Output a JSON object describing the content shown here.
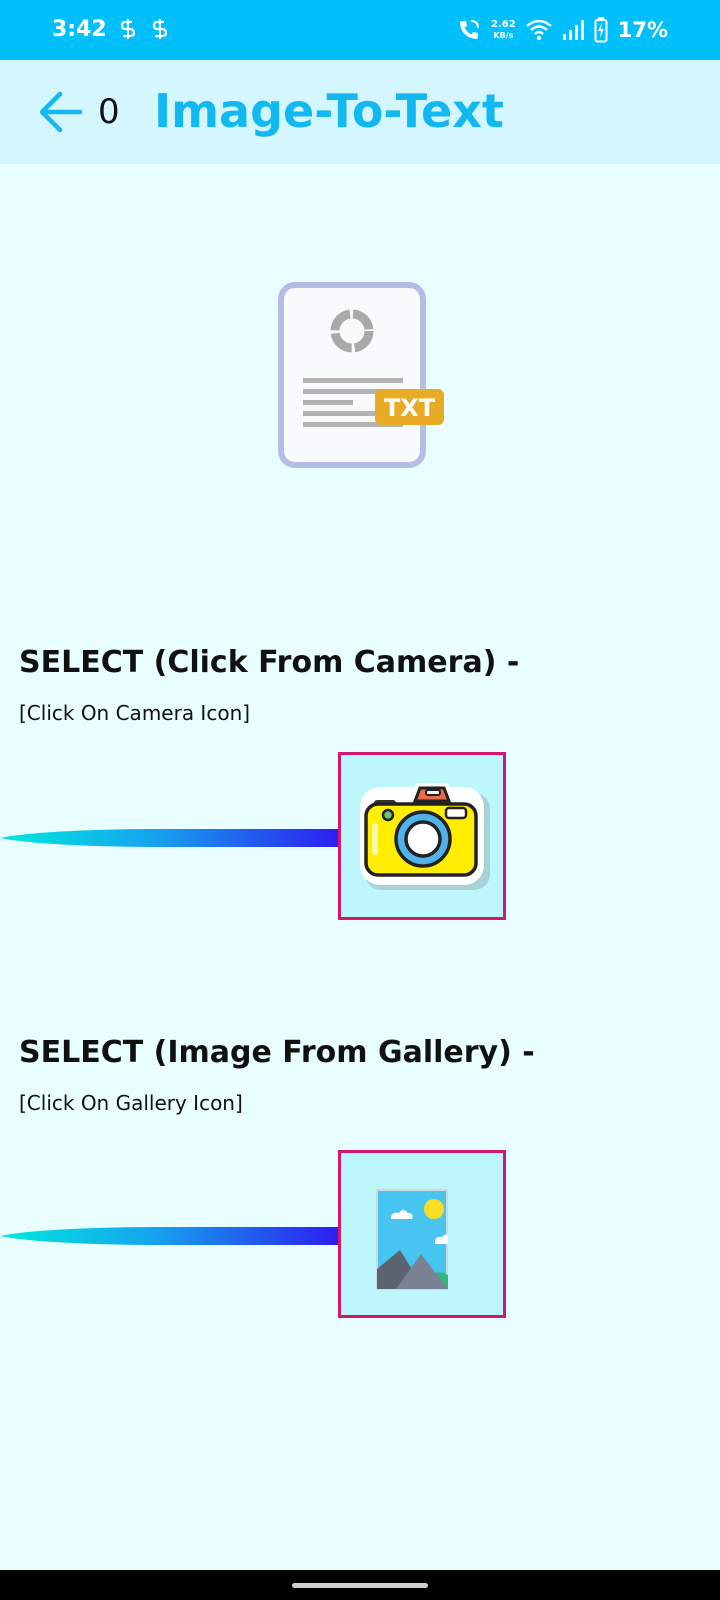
{
  "status_bar": {
    "time": "3:42",
    "speed_value": "2.62",
    "speed_unit": "KB/s",
    "battery": "17%"
  },
  "app_bar": {
    "counter": "0",
    "title": "Image-To-Text",
    "title_color": "#12b8f0"
  },
  "hero": {
    "badge_text": "TXT"
  },
  "camera_section": {
    "title": "SELECT (Click From Camera) -",
    "hint": "[Click On Camera Icon]"
  },
  "gallery_section": {
    "title": "SELECT (Image From Gallery) -",
    "hint": "[Click On Gallery Icon]"
  },
  "colors": {
    "status_bar": "#00c0fb",
    "app_bar": "#d4f6ff",
    "background": "#e8feff",
    "icon_border": "#d4166e",
    "icon_box": "#bdf7fb"
  },
  "icons": {
    "back": "arrow-left-icon",
    "hero": "txt-document-icon",
    "camera": "camera-icon",
    "gallery": "gallery-icon"
  }
}
